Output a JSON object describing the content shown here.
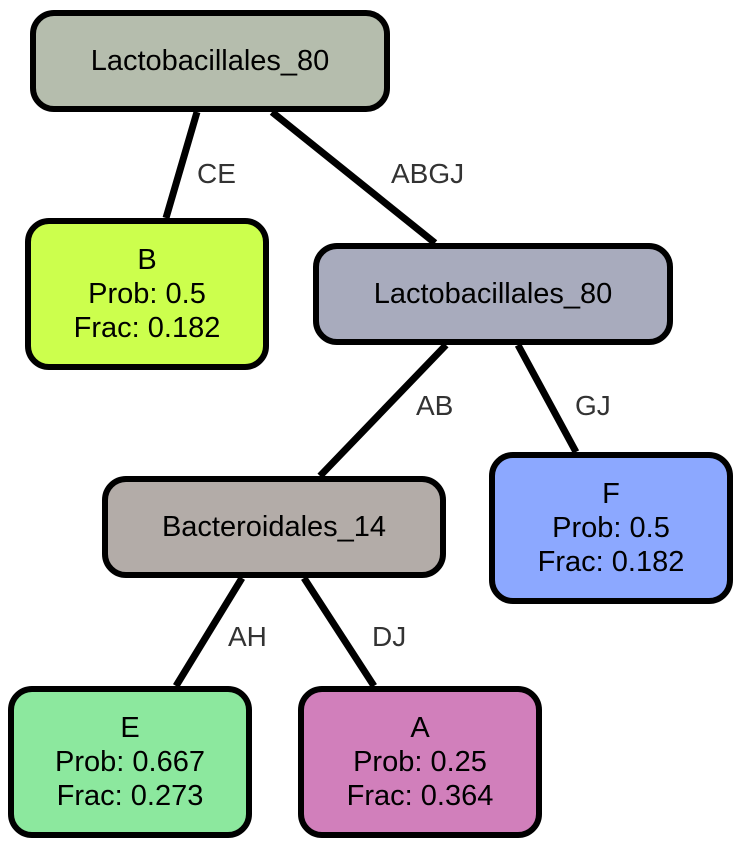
{
  "nodes": {
    "root": {
      "label": "Lactobacillales_80",
      "color": "#b5bdad"
    },
    "b": {
      "label": "B",
      "prob": "Prob: 0.5",
      "frac": "Frac: 0.182",
      "color": "#ccff4d"
    },
    "mid": {
      "label": "Lactobacillales_80",
      "color": "#a8abbd"
    },
    "bact": {
      "label": "Bacteroidales_14",
      "color": "#b3aca8"
    },
    "f": {
      "label": "F",
      "prob": "Prob: 0.5",
      "frac": "Frac: 0.182",
      "color": "#8ca8ff"
    },
    "e": {
      "label": "E",
      "prob": "Prob: 0.667",
      "frac": "Frac: 0.273",
      "color": "#8ce89e"
    },
    "a": {
      "label": "A",
      "prob": "Prob: 0.25",
      "frac": "Frac: 0.364",
      "color": "#d17fbb"
    }
  },
  "edges": {
    "root_b": "CE",
    "root_mid": "ABGJ",
    "mid_bact": "AB",
    "mid_f": "GJ",
    "bact_e": "AH",
    "bact_a": "DJ"
  }
}
